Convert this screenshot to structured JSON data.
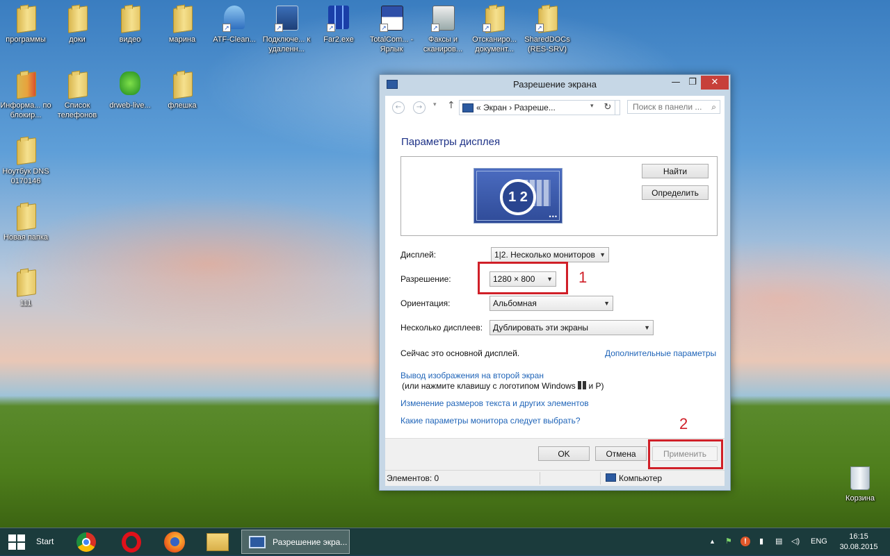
{
  "desktop": {
    "icons": [
      {
        "label": "программы"
      },
      {
        "label": "доки"
      },
      {
        "label": "видео"
      },
      {
        "label": "марина"
      },
      {
        "label": "ATF-Clean..."
      },
      {
        "label": "Подключе... к удаленн..."
      },
      {
        "label": "Far2.exe"
      },
      {
        "label": "TotalCom... - Ярлык"
      },
      {
        "label": "Факсы и сканиров..."
      },
      {
        "label": "Отсканиро... документ..."
      },
      {
        "label": "SharedDOCs (RES-SRV)"
      },
      {
        "label": "Информа... по блокир..."
      },
      {
        "label": "Список телефонов"
      },
      {
        "label": "drweb-live..."
      },
      {
        "label": "флешка"
      },
      {
        "label": "Ноутбук DNS 0170146"
      },
      {
        "label": "Новая папка"
      },
      {
        "label": "111"
      }
    ],
    "recycle_bin": "Корзина"
  },
  "window": {
    "title": "Разрешение экрана",
    "min_glyph": "—",
    "max_glyph": "❐",
    "close_glyph": "✕",
    "address": {
      "crumbs": "«  Экран  ›  Разреше...",
      "back_glyph": "←",
      "forward_glyph": "→",
      "recent_glyph": "▾",
      "up_glyph": "↑",
      "dropdown_glyph": "▾",
      "refresh_glyph": "↻",
      "search_placeholder": "Поиск в панели ...",
      "search_glyph": "⌕"
    },
    "heading": "Параметры дисплея",
    "monitor_numbers": "1 2",
    "monitor_dots": "•••",
    "find_button": "Найти",
    "detect_button": "Определить",
    "fields": {
      "display_label": "Дисплей:",
      "display_value": "1|2. Несколько мониторов",
      "resolution_label": "Разрешение:",
      "resolution_value": "1280 × 800",
      "orientation_label": "Ориентация:",
      "orientation_value": "Альбомная",
      "multiple_label": "Несколько дисплеев:",
      "multiple_value": "Дублировать эти экраны"
    },
    "primary_text": "Сейчас это основной дисплей.",
    "advanced_link": "Дополнительные параметры",
    "project_link": "Вывод изображения на второй экран",
    "project_hint_before": "(или нажмите клавишу с логотипом Windows",
    "project_hint_after": "и P)",
    "text_size_link": "Изменение размеров текста и других элементов",
    "which_link": "Какие параметры монитора следует выбрать?",
    "ok_button": "OK",
    "cancel_button": "Отмена",
    "apply_button": "Применить",
    "status_items": "Элементов: 0",
    "status_location": "Компьютер"
  },
  "annotations": {
    "mark1": "1",
    "mark2": "2",
    "color": "#d01f28"
  },
  "taskbar": {
    "start": "Start",
    "active_task": "Разрешение экра...",
    "language": "ENG",
    "time": "16:15",
    "date": "30.08.2015",
    "tray_up_glyph": "▲",
    "tray_flag_glyph": "⚑",
    "tray_alert_glyph": "!",
    "tray_battery_glyph": "▮",
    "tray_network_glyph": "▤",
    "tray_volume_glyph": "◁)"
  }
}
